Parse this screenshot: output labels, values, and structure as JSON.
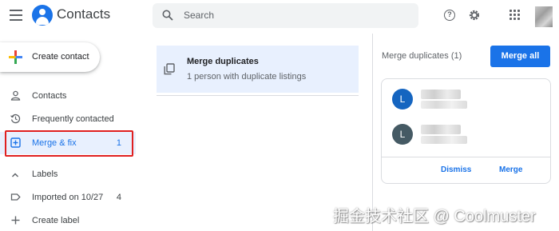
{
  "header": {
    "app_title": "Contacts",
    "search_placeholder": "Search",
    "help_icon": "?"
  },
  "sidebar": {
    "create_contact_label": "Create contact",
    "items": [
      {
        "label": "Contacts",
        "count": "",
        "icon": "person-icon"
      },
      {
        "label": "Frequently contacted",
        "count": "",
        "icon": "history-icon"
      },
      {
        "label": "Merge & fix",
        "count": "1",
        "icon": "merge-fix-icon",
        "active": true
      }
    ],
    "labels_header": "Labels",
    "labels": [
      {
        "label": "Imported on 10/27",
        "count": "4",
        "icon": "label-icon"
      }
    ],
    "create_label": "Create label"
  },
  "main": {
    "card_title": "Merge duplicates",
    "card_subtitle": "1 person with duplicate listings"
  },
  "right_panel": {
    "title": "Merge duplicates (1)",
    "merge_all_label": "Merge all",
    "contacts": [
      {
        "initial": "L",
        "color": "#1565c0"
      },
      {
        "initial": "L",
        "color": "#455a64"
      }
    ],
    "dismiss_label": "Dismiss",
    "merge_label": "Merge"
  },
  "watermark": "掘金技术社区 @ Coolmuster",
  "colors": {
    "accent": "#1a73e8",
    "active_background": "#e8f0fe",
    "highlight_border": "#e02020"
  }
}
